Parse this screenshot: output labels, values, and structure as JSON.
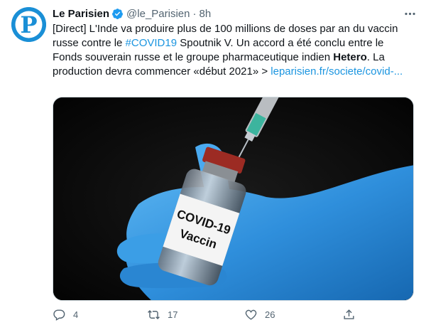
{
  "tweet": {
    "author_name": "Le Parisien",
    "handle": "@le_Parisien",
    "separator": "·",
    "time": "8h",
    "avatar_letter": "P",
    "text": {
      "part1": "[Direct] L'Inde va produire plus de 100 millions de doses par an du vaccin russe contre le ",
      "hashtag": "#COVID19",
      "part2": " Spoutnik V. Un accord a été conclu entre le Fonds souverain russe et le groupe pharmaceutique indien ",
      "bold": "Hetero",
      "part3": ". La production devra commencer «début 2021» > ",
      "link": "leparisien.fr/societe/covid-..."
    },
    "image": {
      "vial_label_line1": "COVID-19",
      "vial_label_line2": "Vaccin"
    },
    "actions": {
      "reply_count": "4",
      "retweet_count": "17",
      "like_count": "26"
    }
  },
  "colors": {
    "accent": "#1b95e0",
    "secondary_text": "#536471",
    "glove": "#3fa0e8",
    "avatar_bg": "#1a8fd6"
  },
  "icons": [
    "verified-icon",
    "more-icon",
    "reply-icon",
    "retweet-icon",
    "like-icon",
    "share-icon"
  ]
}
